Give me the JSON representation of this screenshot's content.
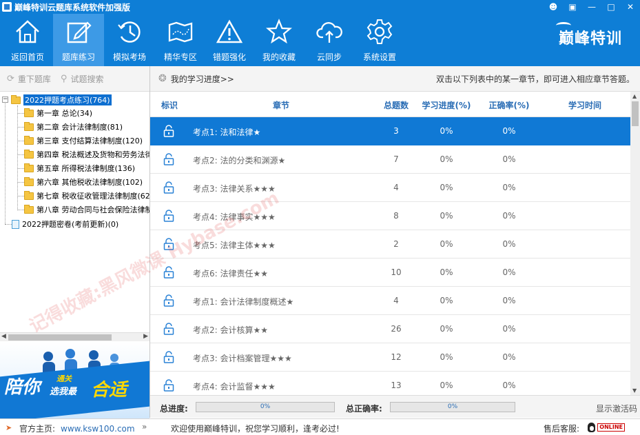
{
  "window": {
    "title": "巅峰特训云题库系统软件加强版",
    "controls": [
      "person-icon",
      "restore-icon",
      "minimize-icon",
      "maximize-icon",
      "close-icon"
    ]
  },
  "toolbar": {
    "items": [
      {
        "label": "返回首页",
        "icon": "home-icon"
      },
      {
        "label": "题库练习",
        "icon": "edit-icon"
      },
      {
        "label": "模拟考场",
        "icon": "clock-icon"
      },
      {
        "label": "精华专区",
        "icon": "map-icon"
      },
      {
        "label": "错题强化",
        "icon": "warning-icon"
      },
      {
        "label": "我的收藏",
        "icon": "star-icon"
      },
      {
        "label": "云同步",
        "icon": "cloud-icon"
      },
      {
        "label": "系统设置",
        "icon": "gear-icon"
      }
    ],
    "active_index": 1,
    "brand": "巅峰特训"
  },
  "left": {
    "reload_label": "重下题库",
    "search_label": "试题搜索",
    "tree_root": "2022押题考点练习(764)",
    "chapters": [
      "第一章 总论(34)",
      "第二章 会计法律制度(81)",
      "第三章 支付结算法律制度(120)",
      "第四章 税法概述及货物和劳务法律",
      "第五章 所得税法律制度(136)",
      "第六章 其他税收法律制度(102)",
      "第七章 税收征收管理法律制度(62",
      "第八章 劳动合同与社会保险法律制"
    ],
    "tree_second": "2022押题密卷(考前更新)(0)",
    "banner": {
      "t1": "陪你",
      "t2": "通关",
      "t3": "选我最",
      "t4": "合适"
    }
  },
  "right": {
    "progress_link": "我的学习进度>>",
    "hint": "双击以下列表中的某一章节，即可进入相应章节答题。",
    "columns": [
      "标识",
      "章节",
      "总题数",
      "学习进度(%)",
      "正确率(%)",
      "学习时间"
    ],
    "rows": [
      {
        "name": "考点1: 法和法律★",
        "total": "3",
        "progress": "0%",
        "accuracy": "0%",
        "time": ""
      },
      {
        "name": "考点2: 法的分类和渊源★",
        "total": "7",
        "progress": "0%",
        "accuracy": "0%",
        "time": ""
      },
      {
        "name": "考点3: 法律关系★★★",
        "total": "4",
        "progress": "0%",
        "accuracy": "0%",
        "time": ""
      },
      {
        "name": "考点4: 法律事实★★★",
        "total": "8",
        "progress": "0%",
        "accuracy": "0%",
        "time": ""
      },
      {
        "name": "考点5: 法律主体★★★",
        "total": "2",
        "progress": "0%",
        "accuracy": "0%",
        "time": ""
      },
      {
        "name": "考点6: 法律责任★★",
        "total": "10",
        "progress": "0%",
        "accuracy": "0%",
        "time": ""
      },
      {
        "name": "考点1: 会计法律制度概述★",
        "total": "4",
        "progress": "0%",
        "accuracy": "0%",
        "time": ""
      },
      {
        "name": "考点2: 会计核算★★",
        "total": "26",
        "progress": "0%",
        "accuracy": "0%",
        "time": ""
      },
      {
        "name": "考点3: 会计档案管理★★★",
        "total": "12",
        "progress": "0%",
        "accuracy": "0%",
        "time": ""
      },
      {
        "name": "考点4: 会计监督★★★",
        "total": "13",
        "progress": "0%",
        "accuracy": "0%",
        "time": ""
      }
    ],
    "selected_row": 0,
    "summary": {
      "total_progress_label": "总进度:",
      "total_progress_value": "0%",
      "total_accuracy_label": "总正确率:",
      "total_accuracy_value": "0%",
      "activation_label": "显示激活码"
    }
  },
  "status": {
    "home_label": "官方主页:",
    "home_url": "www.ksw100.com",
    "welcome": "欢迎使用巅峰特训，祝您学习顺利，逢考必过!",
    "service_label": "售后客服:",
    "online_badge": "ONLINE"
  },
  "watermark": "记得收藏:黑风微课 Hybase.com"
}
